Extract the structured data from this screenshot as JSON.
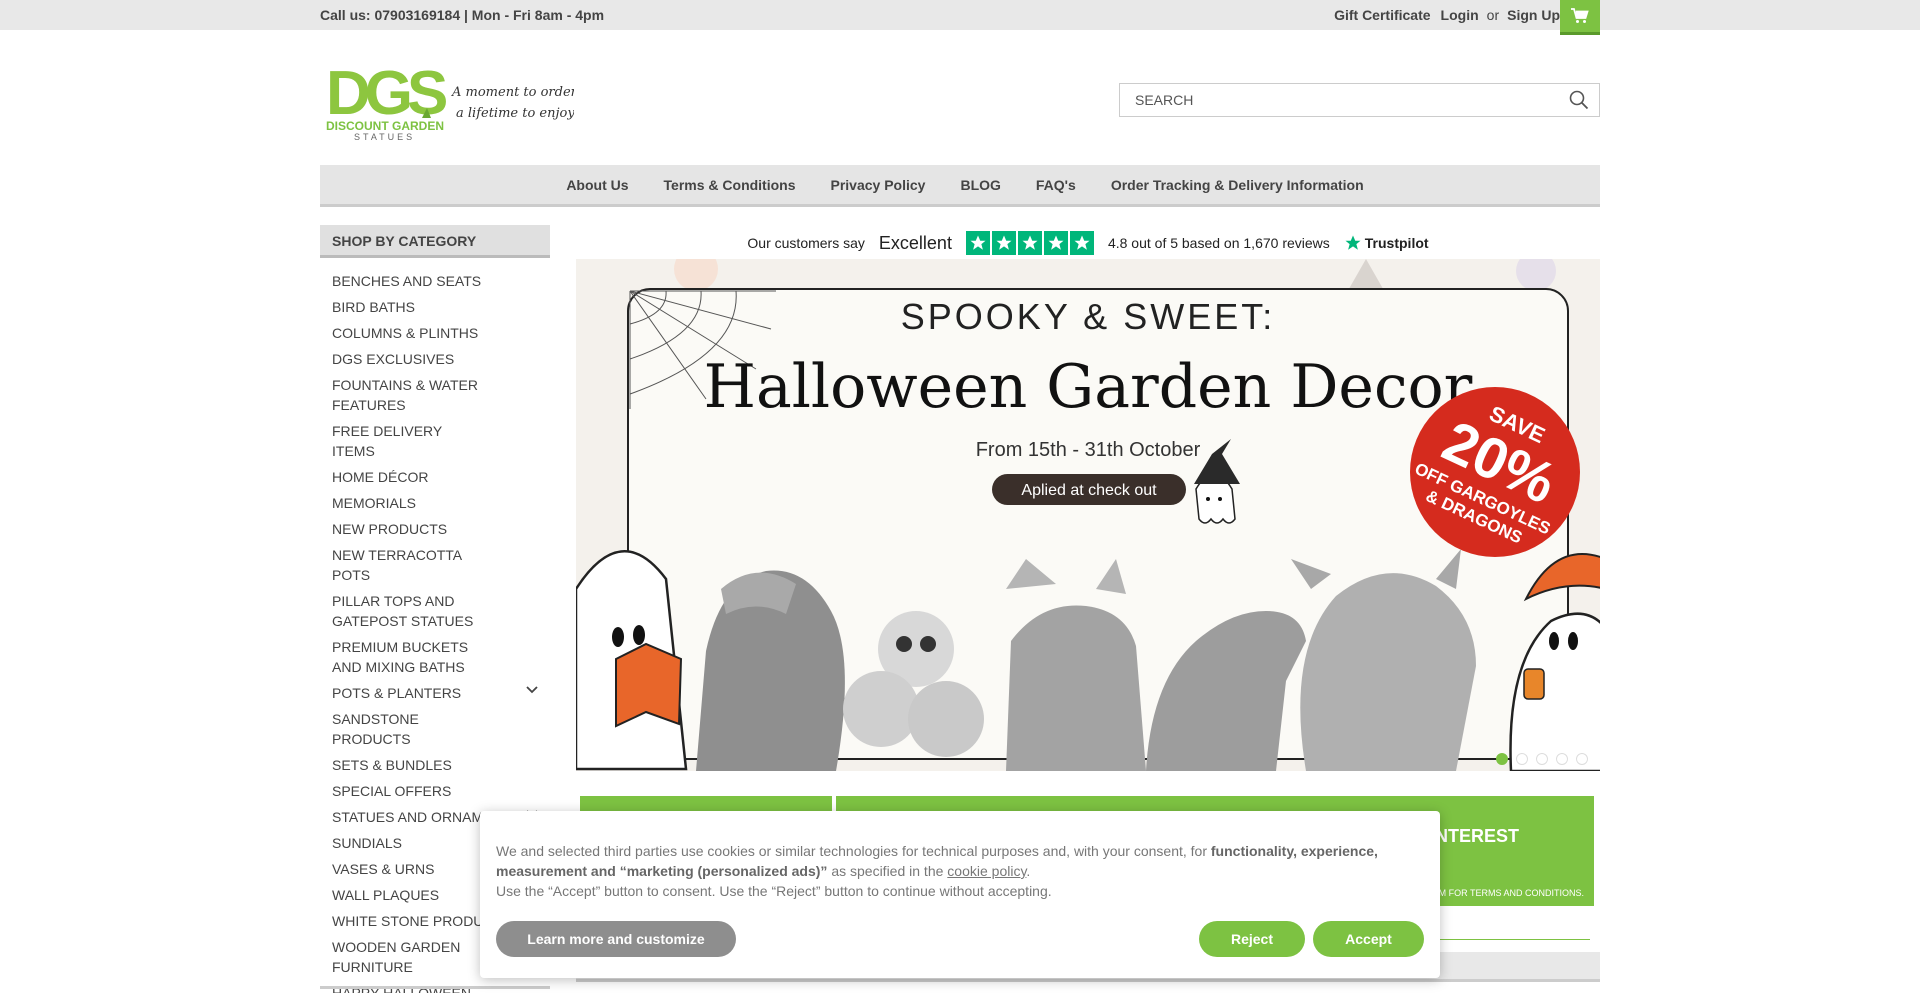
{
  "topbar": {
    "call_text": "Call us: 07903169184 | Mon - Fri 8am - 4pm",
    "gift": "Gift Certificate",
    "login": "Login",
    "or": "or",
    "signup": "Sign Up",
    "cart_icon": "cart-icon"
  },
  "header": {
    "logo_main": "DGS",
    "logo_sub1": "DISCOUNT GARDEN",
    "logo_sub2": "STATUES",
    "tagline1": "A moment to order...",
    "tagline2": "a lifetime to enjoy!",
    "search_placeholder": "SEARCH"
  },
  "nav": [
    "About Us",
    "Terms & Conditions",
    "Privacy Policy",
    "BLOG",
    "FAQ's",
    "Order Tracking & Delivery Information"
  ],
  "sidebar": {
    "heading": "SHOP BY CATEGORY",
    "items": [
      {
        "label": "BENCHES AND SEATS"
      },
      {
        "label": "BIRD BATHS"
      },
      {
        "label": "COLUMNS & PLINTHS"
      },
      {
        "label": "DGS EXCLUSIVES"
      },
      {
        "label": "FOUNTAINS & WATER FEATURES"
      },
      {
        "label": "FREE DELIVERY ITEMS"
      },
      {
        "label": "HOME DÉCOR"
      },
      {
        "label": "MEMORIALS"
      },
      {
        "label": "NEW PRODUCTS"
      },
      {
        "label": "NEW TERRACOTTA POTS"
      },
      {
        "label": "PILLAR TOPS AND GATEPOST STATUES"
      },
      {
        "label": "PREMIUM BUCKETS AND MIXING BATHS"
      },
      {
        "label": "POTS & PLANTERS",
        "expandable": true
      },
      {
        "label": "SANDSTONE PRODUCTS"
      },
      {
        "label": "SETS & BUNDLES"
      },
      {
        "label": "SPECIAL OFFERS"
      },
      {
        "label": "STATUES AND ORNAMENTS",
        "expandable": true
      },
      {
        "label": "SUNDIALS"
      },
      {
        "label": "VASES & URNS"
      },
      {
        "label": "WALL PLAQUES"
      },
      {
        "label": "WHITE STONE PRODUCTS"
      },
      {
        "label": "WOODEN GARDEN FURNITURE"
      },
      {
        "label": "HAPPY HALLOWEEN"
      }
    ]
  },
  "trustpilot": {
    "say": "Our customers say",
    "rating_word": "Excellent",
    "summary": "4.8 out of 5 based on 1,670 reviews",
    "brand": "Trustpilot"
  },
  "banner": {
    "line1": "SPOOKY & SWEET:",
    "line2": "Halloween Garden Decor",
    "dates": "From 15th - 31th October",
    "pill": "Aplied at check out",
    "badge_save": "SAVE",
    "badge_pct": "20%",
    "badge_off1": "OFF GARGOYLES",
    "badge_off2": "& DRAGONS",
    "slide_count": 5,
    "active_slide": 1
  },
  "promo": {
    "title": "INTEREST",
    "small": "M FOR TERMS AND CONDITIONS."
  },
  "cookie": {
    "t1": "We and selected third parties use cookies or similar technologies for technical purposes and, with your consent, for ",
    "b1": "functionality, experience, measurement and “marketing (personalized ads)”",
    "t2": " as specified in the ",
    "link": "cookie policy",
    "t3": ".",
    "line2": "Use the “Accept” button to consent. Use the “Reject” button to continue without accepting.",
    "learn": "Learn more and customize",
    "reject": "Reject",
    "accept": "Accept"
  },
  "colors": {
    "brand_green": "#7dc242",
    "trust_green": "#00b67a",
    "badge_red": "#d52b1e"
  }
}
